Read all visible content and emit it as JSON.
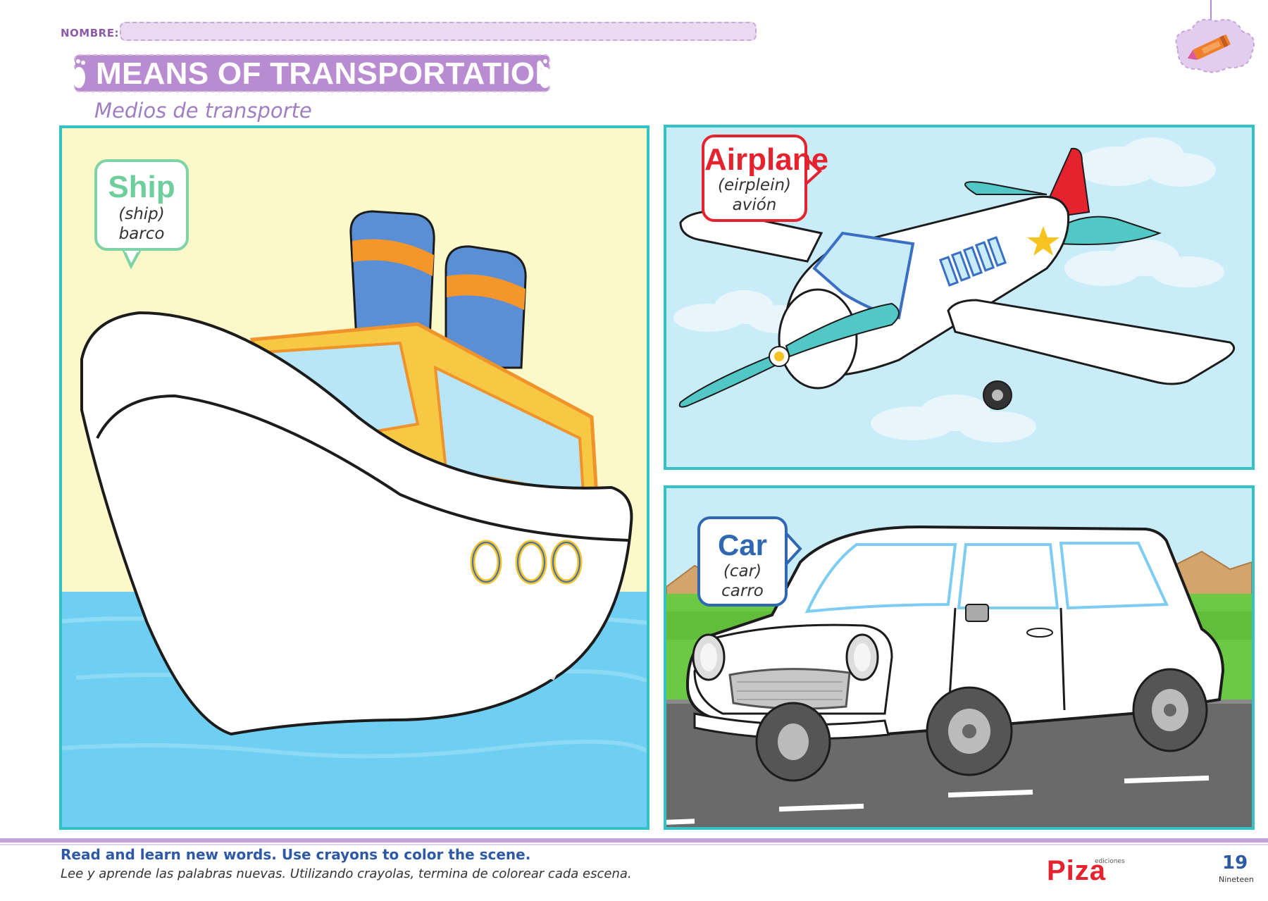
{
  "header": {
    "name_label": "NOMBRE:",
    "title": "MEANS OF TRANSPORTATION",
    "subtitle": "Medios de transporte"
  },
  "panels": {
    "ship": {
      "word": "Ship",
      "pronunciation": "(ship)",
      "translation": "barco"
    },
    "airplane": {
      "word": "Airplane",
      "pronunciation": "(eirplein)",
      "translation": "avión"
    },
    "car": {
      "word": "Car",
      "pronunciation": "(car)",
      "translation": "carro"
    }
  },
  "footer": {
    "instruction_en": "Read and learn new words. Use crayons to color the scene.",
    "instruction_es": "Lee y aprende las palabras nuevas. Utilizando crayolas, termina de colorear cada escena.",
    "publisher_logo": "Piza",
    "publisher_small": "ediciones",
    "page_number": "19",
    "page_word": "Nineteen"
  },
  "colors": {
    "accent_purple": "#b98bd1",
    "panel_border": "#34c2c4",
    "ship_word": "#6fcf9c",
    "airplane_word": "#e5232f",
    "car_word": "#2f67b3",
    "instruction_blue": "#2d59a6"
  },
  "icons": [
    "footprint-icon",
    "crayon-icon"
  ]
}
